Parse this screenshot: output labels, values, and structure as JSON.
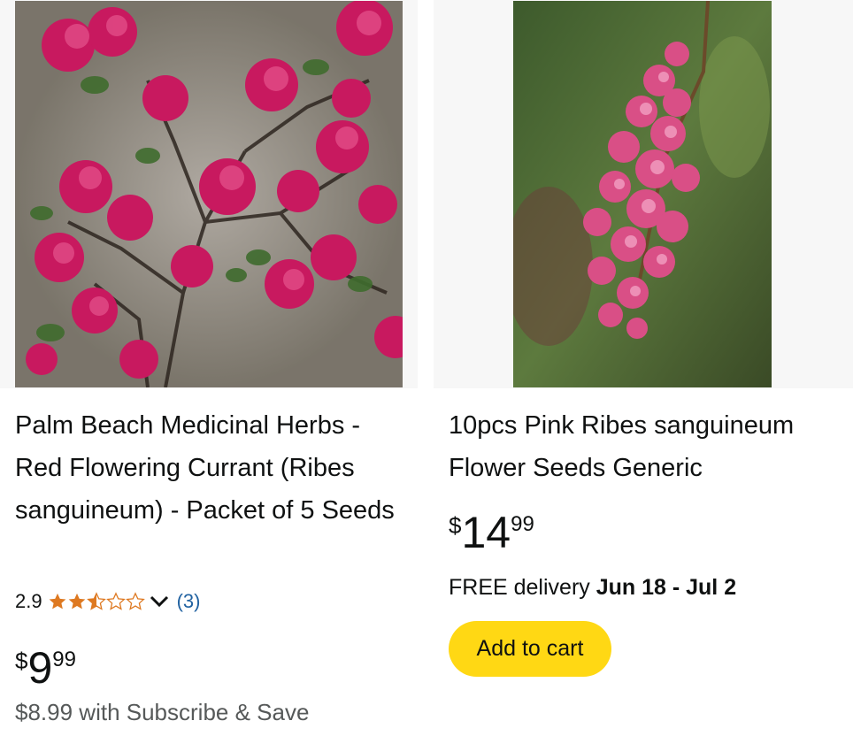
{
  "products": [
    {
      "title": "Palm Beach Medicinal Herbs - Red Flowering Currant (Ribes sanguineum) - Packet of 5 Seeds",
      "rating_value": "2.9",
      "rating_stars": 2.9,
      "rating_count": "(3)",
      "price_symbol": "$",
      "price_whole": "9",
      "price_fraction": "99",
      "subscribe_text": "$8.99 with Subscribe & Save"
    },
    {
      "title": "10pcs Pink Ribes sanguineum Flower Seeds Generic",
      "price_symbol": "$",
      "price_whole": "14",
      "price_fraction": "99",
      "delivery_prefix": "FREE delivery",
      "delivery_dates": "Jun 18 - Jul 2",
      "add_to_cart_label": "Add to cart"
    }
  ],
  "colors": {
    "star": "#de7921",
    "link": "#2162a1",
    "cart_button": "#ffd814",
    "muted_text": "#565959"
  }
}
